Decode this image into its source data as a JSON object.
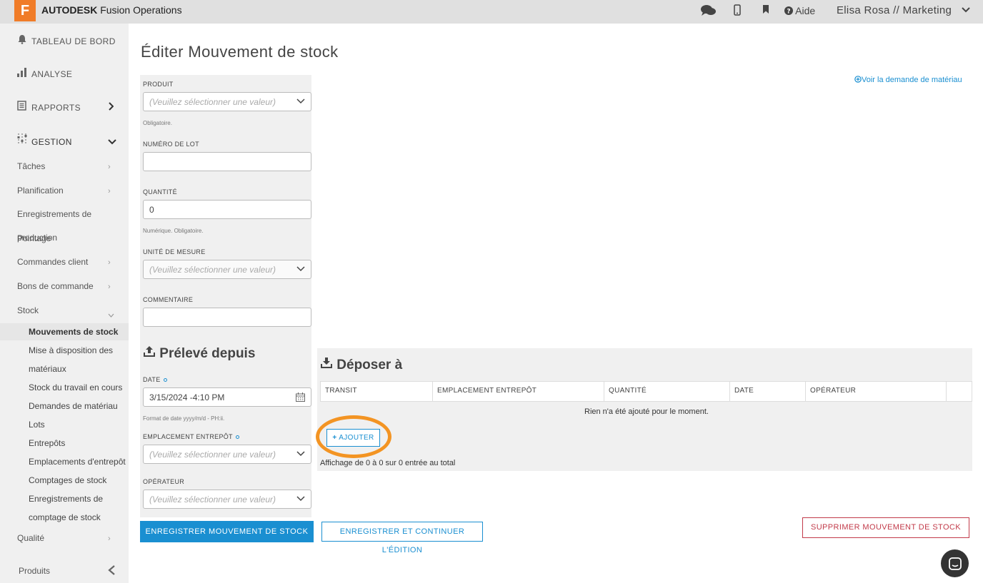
{
  "header": {
    "logo_letter": "F",
    "brand_bold": "AUTODESK",
    "brand_rest": " Fusion Operations",
    "help": "Aide",
    "user": "Elisa Rosa // Marketing",
    "icons": [
      "chat-icon",
      "mobile-icon",
      "bookmark-icon",
      "help-icon",
      "chevron-down-icon"
    ]
  },
  "sidebar": {
    "main": [
      {
        "label": "TABLEAU DE BORD",
        "icon": "bell-icon"
      },
      {
        "label": "ANALYSE",
        "icon": "bar-chart-icon"
      },
      {
        "label": "RAPPORTS",
        "icon": "report-icon"
      },
      {
        "label": "GESTION",
        "icon": "sliders-icon"
      }
    ],
    "sub": [
      "Tâches",
      "Planification",
      "Enregistrements de",
      "production",
      "Pointage",
      "Commandes client",
      "Bons de commande",
      "Stock",
      "Qualité",
      "Produits"
    ],
    "stock_items": [
      "Mouvements de stock",
      "Mise à disposition des",
      "matériaux",
      "Stock du travail en cours",
      "Demandes de matériau",
      "Lots",
      "Entrepôts",
      "Emplacements d'entrepôt",
      "Comptages de stock",
      "Enregistrements de",
      "comptage de stock"
    ]
  },
  "page": {
    "title": "Éditer Mouvement de stock",
    "voir_link": "Voir la demande de matériau"
  },
  "form": {
    "produit_label": "PRODUIT",
    "produit_placeholder": "(Veuillez sélectionner une valeur)",
    "produit_help": "Obligatoire.",
    "lot_label": "NUMÉRO DE LOT",
    "lot_value": "",
    "qte_label": "QUANTITÉ",
    "qte_value": "0",
    "qte_help": "Numérique. Obligatoire.",
    "unite_label": "UNITÉ DE MESURE",
    "unite_placeholder": "(Veuillez sélectionner une valeur)",
    "comment_label": "COMMENTAIRE",
    "comment_value": ""
  },
  "preleve": {
    "title": "Prélevé depuis",
    "date_label": "DATE",
    "date_value": "3/15/2024 -4:10 PM",
    "date_help": "Format de date yyyy/m/d - PH:ii.",
    "empl_label": "EMPLACEMENT ENTREPÔT",
    "empl_placeholder": "(Veuillez sélectionner une valeur)",
    "oper_label": "OPÉRATEUR",
    "oper_placeholder": "(Veuillez sélectionner une valeur)"
  },
  "depose": {
    "title": "Déposer à",
    "columns": [
      "TRANSIT",
      "EMPLACEMENT ENTREPÔT",
      "QUANTITÉ",
      "DATE",
      "OPÉRATEUR"
    ],
    "empty": "Rien n'a été ajouté pour le moment.",
    "add": "AJOUTER",
    "showing": "Affichage de 0 à 0 sur 0 entrée au total"
  },
  "buttons": {
    "save": "ENREGISTRER MOUVEMENT DE STOCK",
    "continue": "ENREGISTRER ET CONTINUER L'ÉDITION",
    "delete": "SUPPRIMER MOUVEMENT DE STOCK"
  },
  "colors": {
    "accent": "#1a8fd1",
    "orange": "#f07c28",
    "danger": "#c23b4a",
    "highlight": "#f39423"
  }
}
